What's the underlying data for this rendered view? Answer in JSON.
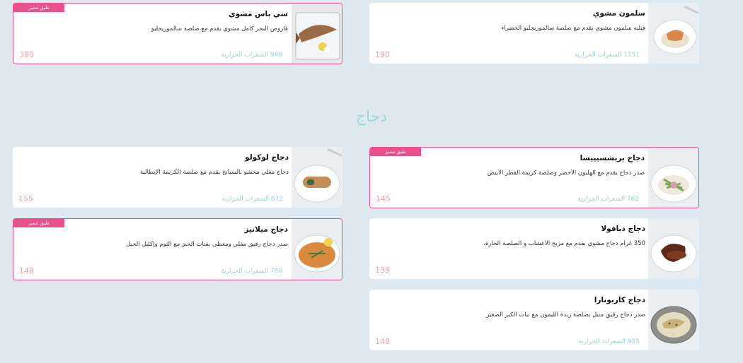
{
  "colors": {
    "background": "#dde8f1",
    "featured_border": "#e9508d",
    "calories": "#8fd4cf",
    "price": "#f2a3a3",
    "section_title": "#9fd9d3"
  },
  "section": {
    "title": "دجاج"
  },
  "cards": {
    "salmon": {
      "title": "سلمون مشوي",
      "desc": "فيليه سلمون مشوي يقدم مع صلصة سالموريجليو الخضراء",
      "calories": "1151 السعرات الحرارية",
      "price": "190",
      "featured": false,
      "icon": "salmon-dish-icon"
    },
    "seabass": {
      "title": "سي باس مشوي",
      "desc": "قاروص البحر كامل مشوي يقدم مع صلصة سالموريجليو",
      "calories": "940 السعرات الحرارية",
      "price": "380",
      "featured": true,
      "badge": "طبق مميز",
      "icon": "seabass-dish-icon"
    },
    "bresaola": {
      "title": "دجاج بريشسيييسا",
      "desc": "صدر دجاج يقدم مع الهليون الأخضر وصلصة كريمة الفطر الأبيض",
      "calories": "762 السعرات الحرارية",
      "price": "145",
      "featured": true,
      "badge": "طبق مميز",
      "icon": "chicken-asparagus-icon"
    },
    "cocolo": {
      "title": "دجاج لوكولو",
      "desc": "دجاج مقلي محشو بالسبانخ يقدم مع صلصة الكريمة الإيطالية",
      "calories": "872 السعرات الحرارية",
      "price": "155",
      "featured": false,
      "icon": "chicken-roll-icon"
    },
    "diavola": {
      "title": "دجاج ديافولا",
      "desc": "350 غرام دجاج مشوي يقدم مع مزيج الأعشاب و الصلصة الحارة.",
      "calories": "",
      "price": "139",
      "featured": false,
      "icon": "grilled-chicken-icon"
    },
    "milanese": {
      "title": "دجاج ميلانيز",
      "desc": "صدر دجاج رقيق مقلي ومغطى بفتات الخبز مع الثوم وإكليل الجبل",
      "calories": "780 السعرات الحرارية",
      "price": "148",
      "featured": true,
      "badge": "طبق مميز",
      "icon": "chicken-milanese-icon"
    },
    "carbonara": {
      "title": "دجاج كاربونارا",
      "desc": "صدر دجاج رقيق متبل بصلصة زبدة الليمون مع نبات الكبر الصغير",
      "calories": "955 السعرات الحرارية",
      "price": "148",
      "featured": false,
      "icon": "chicken-lemon-icon"
    }
  }
}
